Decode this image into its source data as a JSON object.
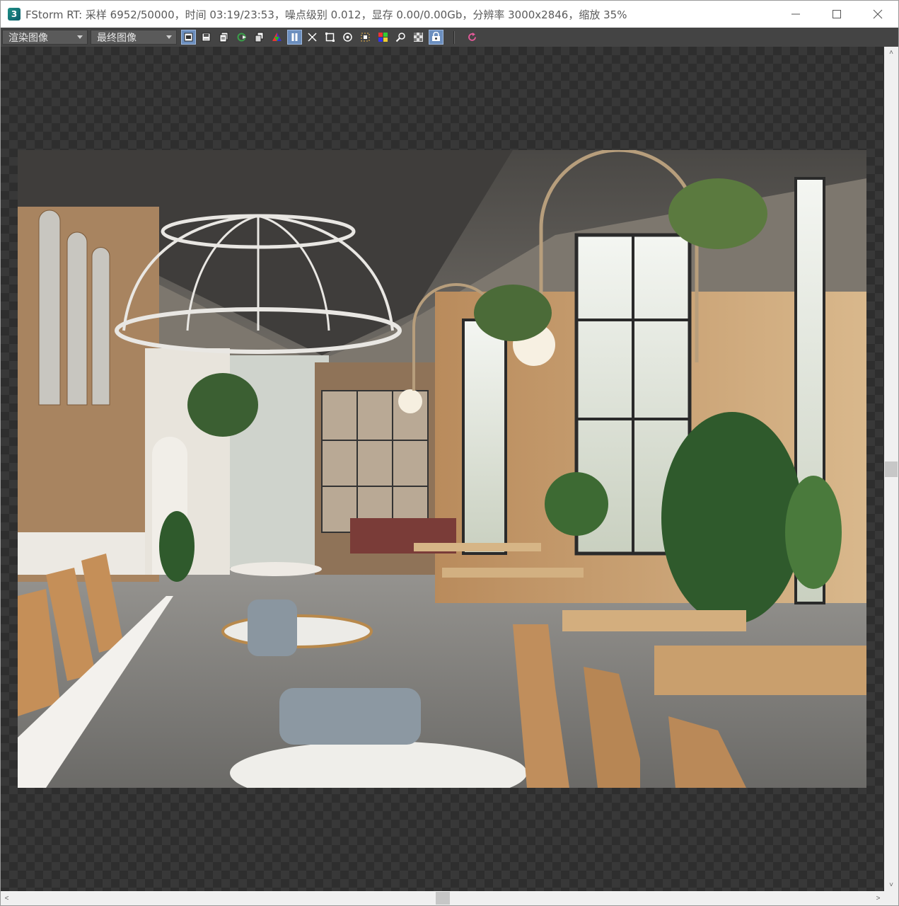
{
  "window": {
    "title": "FStorm RT: 采样 6952/50000，时间 03:19/23:53，噪点级别 0.012，显存 0.00/0.00Gb，分辨率 3000x2846，缩放 35%",
    "icon_label": "3",
    "minimize_icon": "minimize-icon",
    "maximize_icon": "maximize-icon",
    "close_icon": "close-icon"
  },
  "toolbar": {
    "channel_select": "渲染图像",
    "image_select": "最终图像",
    "tools": [
      {
        "name": "render-region-icon",
        "active": true
      },
      {
        "name": "save-image-icon",
        "active": false
      },
      {
        "name": "save-all-icon",
        "active": false
      },
      {
        "name": "refresh-arrow-icon",
        "active": false
      },
      {
        "name": "copy-icon",
        "active": false
      },
      {
        "name": "rgb-channels-icon",
        "active": false
      },
      {
        "name": "pause-icon",
        "active": true
      },
      {
        "name": "fit-view-icon",
        "active": false
      },
      {
        "name": "crop-frame-icon",
        "active": false
      },
      {
        "name": "focus-target-icon",
        "active": false
      },
      {
        "name": "region-select-icon",
        "active": false
      },
      {
        "name": "color-palette-icon",
        "active": false
      },
      {
        "name": "zoom-lens-icon",
        "active": false
      },
      {
        "name": "checker-alpha-icon",
        "active": false
      },
      {
        "name": "camera-lock-icon",
        "active": true
      },
      {
        "name": "reload-icon",
        "active": false
      }
    ]
  },
  "scrollbars": {
    "up_arrow": "˄",
    "down_arrow": "˅",
    "left_arrow": "<",
    "right_arrow": ">"
  },
  "colors": {
    "toolbar_bg": "#444444",
    "active_tool": "#6c8fbf",
    "canvas_checker": "#383838"
  }
}
